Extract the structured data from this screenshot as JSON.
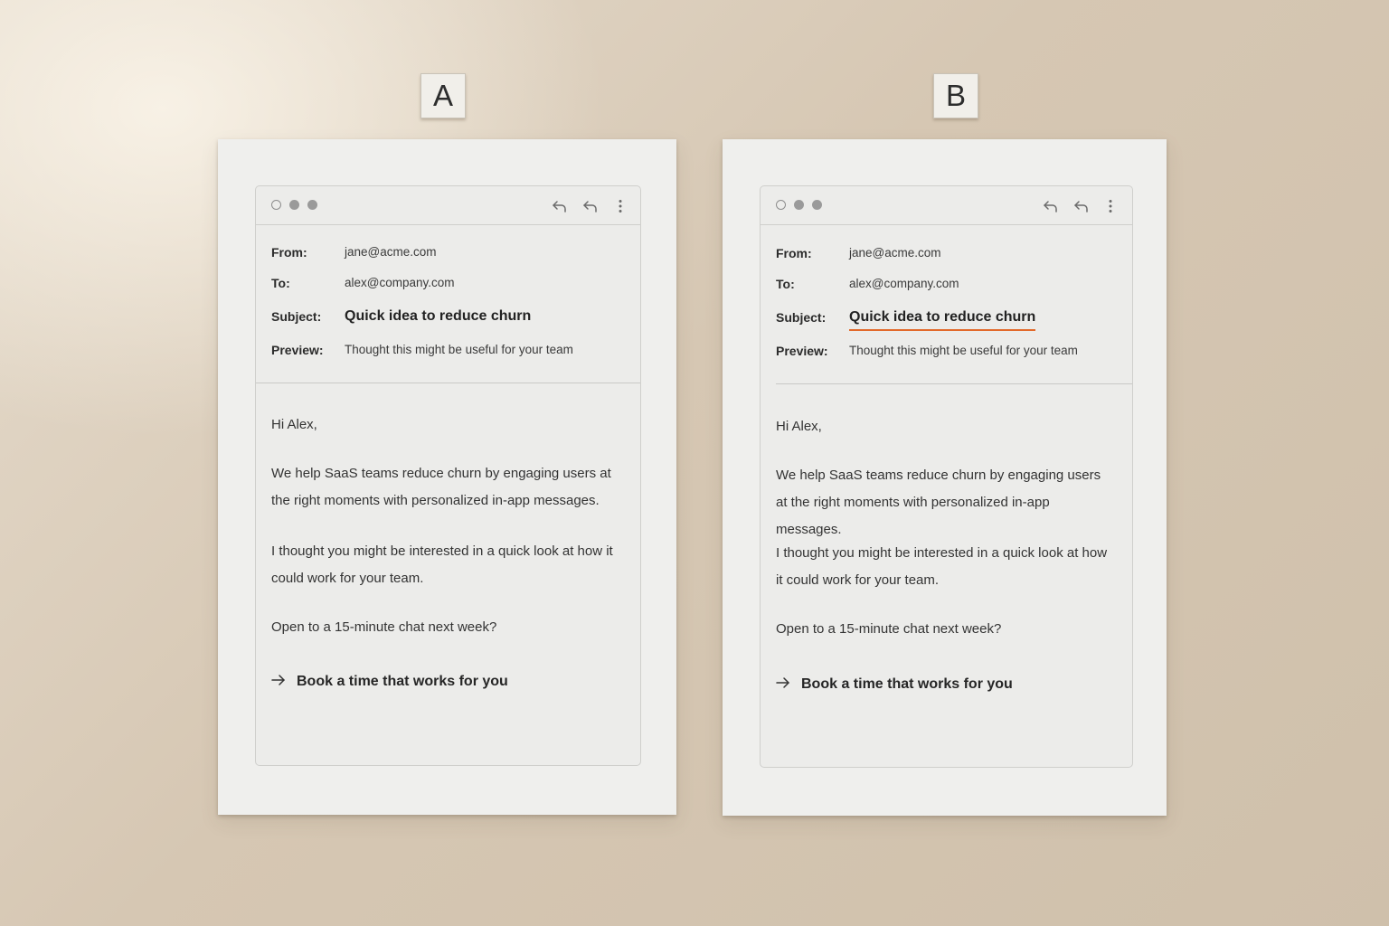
{
  "colors": {
    "accent_underline": "#e2692a",
    "background": "#d9ccba",
    "paper": "#efefed"
  },
  "variants": [
    {
      "tag": "A",
      "icons": [
        "reply-icon",
        "reply-all-icon",
        "more-vertical-icon"
      ],
      "header": {
        "from_label": "From:",
        "from_value": "jane@acme.com",
        "to_label": "To:",
        "to_value": "alex@company.com",
        "subject_label": "Subject:",
        "subject_value": "Quick idea to reduce churn",
        "preview_label": "Preview:",
        "preview_value": "Thought this might be useful for your team"
      },
      "body": {
        "greeting": "Hi Alex,",
        "paragraph1": "We help SaaS teams reduce churn by engaging users at the right moments with personalized in-app messages.",
        "paragraph2": "I thought you might be interested in a quick look at how it could work for your team.",
        "paragraph3": "Open to a 15-minute chat next week?",
        "cta": "Book a time that works for you"
      }
    },
    {
      "tag": "B",
      "icons": [
        "reply-icon",
        "reply-all-icon",
        "more-vertical-icon"
      ],
      "subject_highlighted": true,
      "header": {
        "from_label": "From:",
        "from_value": "jane@acme.com",
        "to_label": "To:",
        "to_value": "alex@company.com",
        "subject_label": "Subject:",
        "subject_value": "Quick idea to reduce churn",
        "preview_label": "Preview:",
        "preview_value": "Thought this might be useful for your team"
      },
      "body": {
        "greeting": "Hi Alex,",
        "paragraph1": "We help SaaS teams reduce churn by engaging users at the right moments with personalized in-app messages.",
        "paragraph2": "I thought you might be interested in a quick look at how it could work for your team.",
        "paragraph3": "Open to a 15-minute chat next week?",
        "cta": "Book a time that works for you"
      }
    }
  ]
}
